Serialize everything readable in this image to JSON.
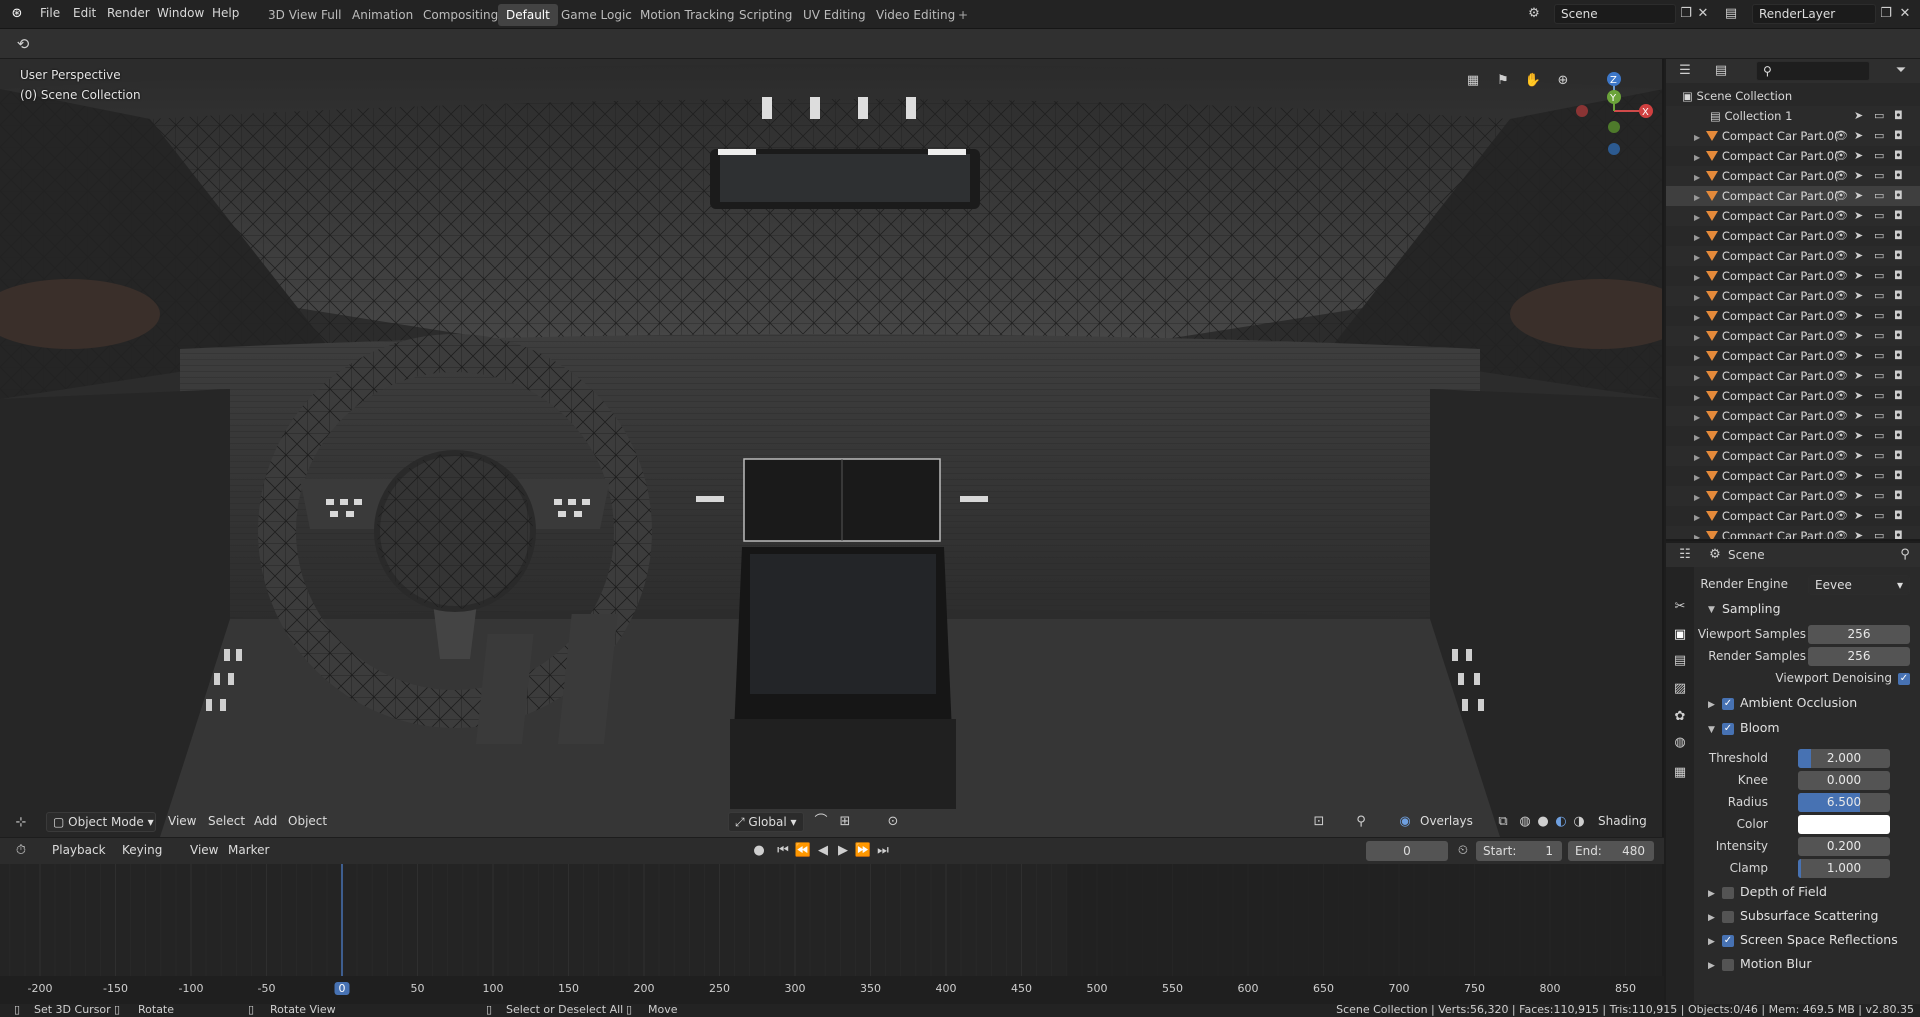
{
  "menu": [
    "File",
    "Edit",
    "Render",
    "Window",
    "Help"
  ],
  "workspaces": [
    "3D View Full",
    "Animation",
    "Compositing",
    "Default",
    "Game Logic",
    "Motion Tracking",
    "Scripting",
    "UV Editing",
    "Video Editing"
  ],
  "active_workspace": "Default",
  "add_tab": "+",
  "scene_field": "Scene",
  "layer_field": "RenderLayer",
  "viewport": {
    "perspective": "User Perspective",
    "collection": "(0) Scene Collection",
    "axis_x": "X",
    "axis_y": "Y",
    "axis_z": "Z"
  },
  "vp_header": {
    "mode": "Object Mode",
    "view": "View",
    "select": "Select",
    "add": "Add",
    "object": "Object",
    "orientation": "Global",
    "overlays": "Overlays",
    "shading": "Shading"
  },
  "timeline": {
    "playback": "Playback",
    "keying": "Keying",
    "view": "View",
    "marker": "Marker",
    "current_frame": "0",
    "start_label": "Start:",
    "start": "1",
    "end_label": "End:",
    "end": "480",
    "ruler": [
      "-200",
      "-150",
      "-100",
      "-50",
      "0",
      "50",
      "100",
      "150",
      "200",
      "250",
      "300",
      "350",
      "400",
      "450",
      "500",
      "550",
      "600",
      "650",
      "700",
      "750",
      "800",
      "850"
    ]
  },
  "outliner": {
    "root": "Scene Collection",
    "collection": "Collection 1",
    "items": [
      "Compact Car Part.0(",
      "Compact Car Part.0(",
      "Compact Car Part.0(",
      "Compact Car Part.0(",
      "Compact Car Part.0",
      "Compact Car Part.0",
      "Compact Car Part.0",
      "Compact Car Part.0",
      "Compact Car Part.0",
      "Compact Car Part.0",
      "Compact Car Part.0",
      "Compact Car Part.0",
      "Compact Car Part.0",
      "Compact Car Part.0",
      "Compact Car Part.0",
      "Compact Car Part.0",
      "Compact Car Part.0",
      "Compact Car Part.0",
      "Compact Car Part.0",
      "Compact Car Part.0",
      "Compact Car Part.0"
    ]
  },
  "properties": {
    "context": "Scene",
    "render_engine_label": "Render Engine",
    "render_engine": "Eevee",
    "sampling": "Sampling",
    "viewport_samples_label": "Viewport Samples",
    "viewport_samples": "256",
    "render_samples_label": "Render Samples",
    "render_samples": "256",
    "viewport_denoising": "Viewport Denoising",
    "ambient_occlusion": "Ambient Occlusion",
    "bloom": "Bloom",
    "threshold_label": "Threshold",
    "threshold": "2.000",
    "knee_label": "Knee",
    "knee": "0.000",
    "radius_label": "Radius",
    "radius": "6.500",
    "color_label": "Color",
    "intensity_label": "Intensity",
    "intensity": "0.200",
    "clamp_label": "Clamp",
    "clamp": "1.000",
    "depth_of_field": "Depth of Field",
    "subsurface_scattering": "Subsurface Scattering",
    "screen_space_reflections": "Screen Space Reflections",
    "motion_blur": "Motion Blur"
  },
  "status": {
    "set_cursor": "Set 3D Cursor",
    "rotate": "Rotate",
    "rotate_view": "Rotate View",
    "select_deselect": "Select or Deselect All",
    "move": "Move",
    "stats": "Scene Collection | Verts:56,320 | Faces:110,915 | Tris:110,915 | Objects:0/46 | Mem: 469.5 MB | v2.80.35"
  },
  "colors": {
    "accent": "#4772b3",
    "mesh_icon": "#e58a3a",
    "active_tab": "#434343"
  }
}
